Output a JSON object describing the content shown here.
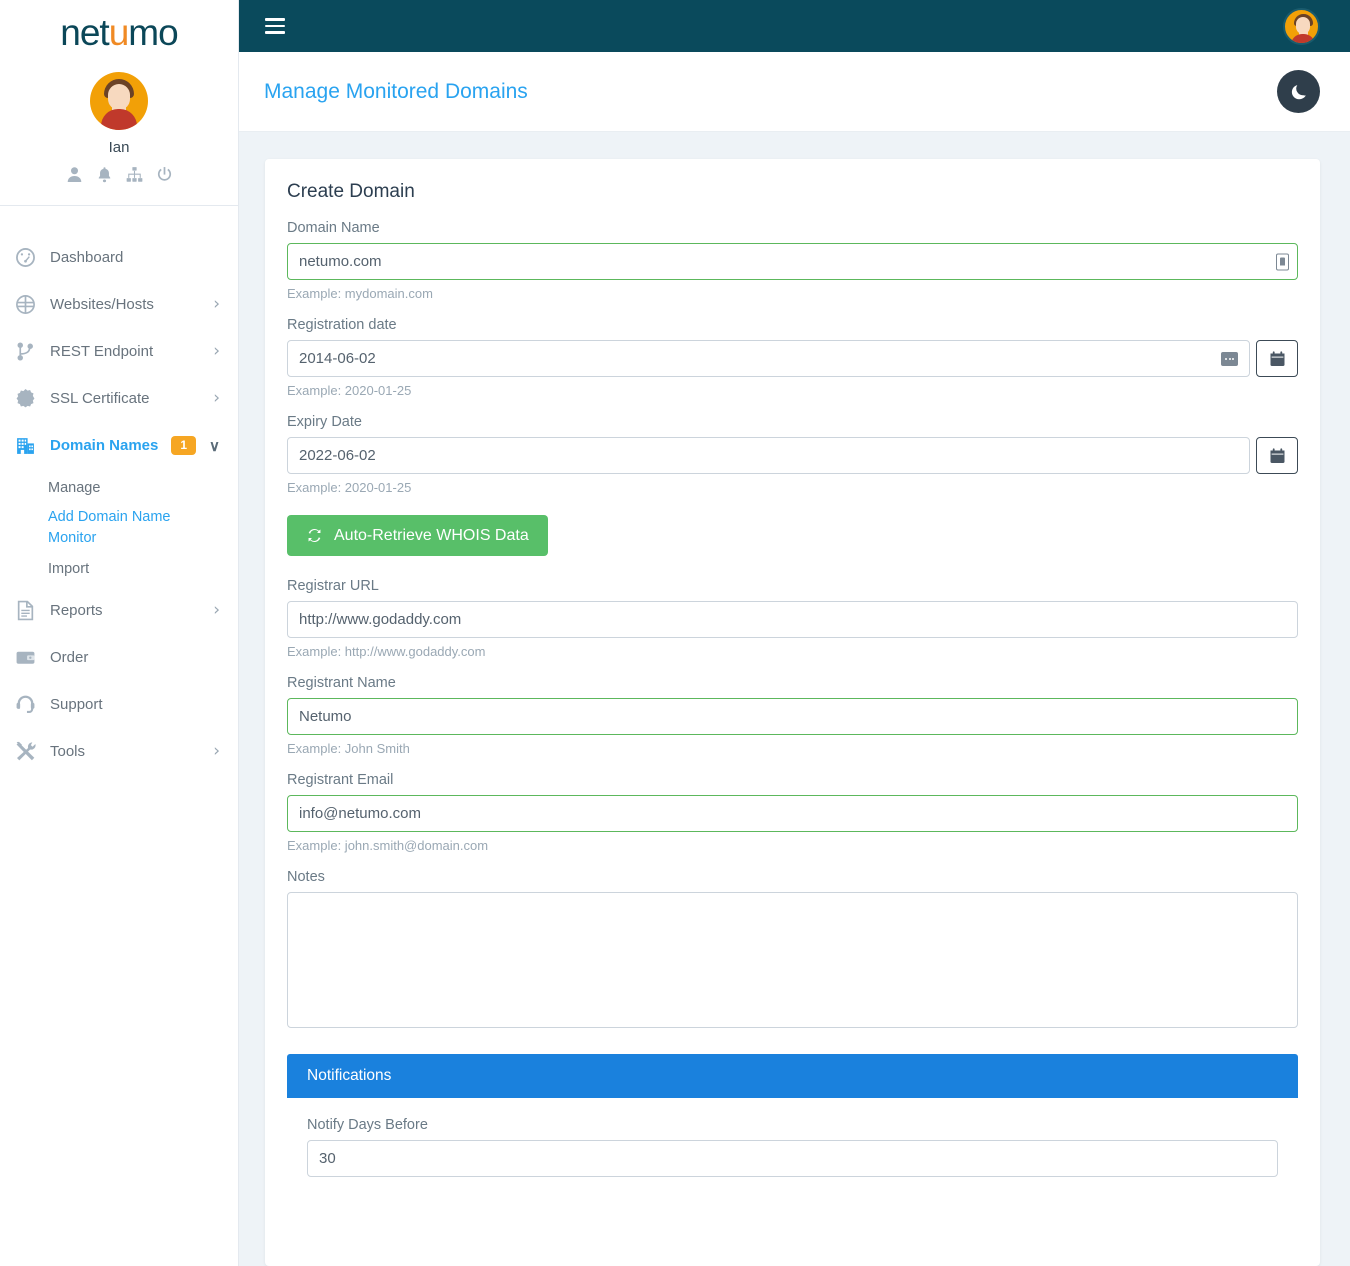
{
  "brand": {
    "name_before": "net",
    "flame": "u",
    "name_after": "mo"
  },
  "sidebar": {
    "profile": {
      "name": "Ian",
      "avatar": "user-avatar"
    },
    "profile_icons": [
      {
        "name": "profile-icon"
      },
      {
        "name": "notifications-bell-icon"
      },
      {
        "name": "sitemap-icon"
      },
      {
        "name": "power-icon"
      }
    ],
    "items": [
      {
        "label": "Dashboard",
        "icon": "dashboard-icon",
        "chevron": "",
        "active": false
      },
      {
        "label": "Websites/Hosts",
        "icon": "globe-icon",
        "chevron": "›",
        "active": false
      },
      {
        "label": "REST Endpoint",
        "icon": "code-branch-icon",
        "chevron": "›",
        "active": false
      },
      {
        "label": "SSL Certificate",
        "icon": "certificate-icon",
        "chevron": "›",
        "active": false
      },
      {
        "label": "Domain Names",
        "icon": "building-icon",
        "chevron": "∨",
        "active": true,
        "badge": "1"
      }
    ],
    "subitems": [
      {
        "label": "Manage",
        "active": false
      },
      {
        "label": "Add Domain Name Monitor",
        "active": true
      },
      {
        "label": "Import",
        "active": false
      }
    ],
    "items_after": [
      {
        "label": "Reports",
        "icon": "report-icon",
        "chevron": "›",
        "active": false
      },
      {
        "label": "Order",
        "icon": "wallet-icon",
        "chevron": "",
        "active": false
      },
      {
        "label": "Support",
        "icon": "headset-icon",
        "chevron": "",
        "active": false
      },
      {
        "label": "Tools",
        "icon": "tools-icon",
        "chevron": "›",
        "active": false
      }
    ]
  },
  "topbar": {
    "menu_toggle": "hamburger-menu",
    "avatar": "user-avatar-small"
  },
  "pagehead": {
    "title": "Manage Monitored Domains",
    "darkmode": "moon-icon"
  },
  "form": {
    "card_title": "Create Domain",
    "domain_name": {
      "label": "Domain Name",
      "value": "netumo.com",
      "placeholder": "netumo.com",
      "hint": "Example: mydomain.com"
    },
    "registration_date": {
      "label": "Registration date",
      "value": "2014-06-02",
      "placeholder": "2020-01-25",
      "hint": "Example: 2020-01-25"
    },
    "expiry_date": {
      "label": "Expiry Date",
      "value": "2022-06-02",
      "placeholder": "2020-01-25",
      "hint": "Example: 2020-01-25"
    },
    "whois_button": "Auto-Retrieve WHOIS Data",
    "registrar_url": {
      "label": "Registrar URL",
      "value": "http://www.godaddy.com",
      "placeholder": "http://www.godaddy.com",
      "hint": "Example: http://www.godaddy.com"
    },
    "registrant_name": {
      "label": "Registrant Name",
      "value": "Netumo",
      "placeholder": "John Smith",
      "hint": "Example: John Smith"
    },
    "registrant_email": {
      "label": "Registrant Email",
      "value": "info@netumo.com",
      "placeholder": "john.smith@domain.com",
      "hint": "Example: john.smith@domain.com"
    },
    "notes": {
      "label": "Notes",
      "value": "",
      "placeholder": ""
    },
    "notifications": {
      "panel_title": "Notifications",
      "notify_days": {
        "label": "Notify Days Before",
        "value": "30",
        "placeholder": "30"
      }
    }
  },
  "colors": {
    "brand_dark": "#0a4a5c",
    "accent_blue": "#29a3f0",
    "panel_blue": "#1a81dd",
    "green": "#58bf69",
    "badge_orange": "#f6a623",
    "valid_border": "#5cb85c",
    "page_bg": "#eef3f7"
  }
}
